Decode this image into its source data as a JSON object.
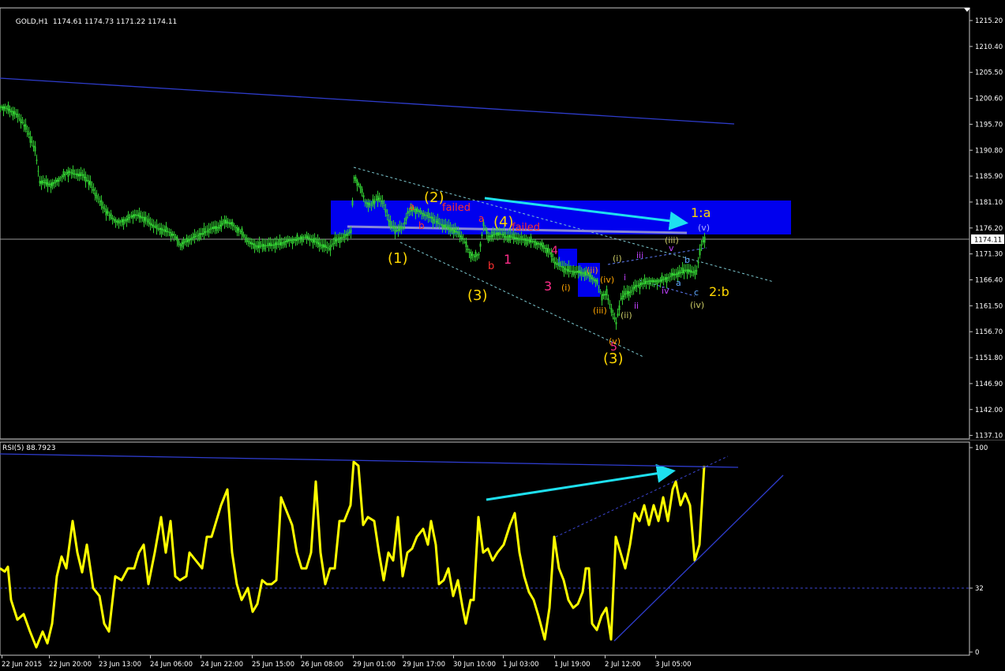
{
  "header": {
    "symbol": "GOLD,H1",
    "ohlc": "1174.61 1174.73 1171.22 1174.11",
    "menu_icon": "triangle-down-icon"
  },
  "rsi_header": "RSI(5) 88.7923",
  "price_axis": {
    "ticks": [
      "1215.20",
      "1210.40",
      "1205.50",
      "1200.60",
      "1195.70",
      "1190.80",
      "1185.90",
      "1181.10",
      "1176.20",
      "1171.30",
      "1166.40",
      "1161.50",
      "1156.70",
      "1151.80",
      "1146.90",
      "1142.00",
      "1137.10"
    ],
    "current_price": "1174.11"
  },
  "rsi_axis": {
    "ticks": [
      "100",
      "32",
      "0"
    ]
  },
  "time_axis": {
    "ticks": [
      "22 Jun 2015",
      "22 Jun 20:00",
      "23 Jun 13:00",
      "24 Jun 06:00",
      "24 Jun 22:00",
      "25 Jun 15:00",
      "26 Jun 08:00",
      "29 Jun 01:00",
      "29 Jun 17:00",
      "30 Jun 10:00",
      "1 Jul 03:00",
      "1 Jul 19:00",
      "2 Jul 12:00",
      "3 Jul 05:00"
    ]
  },
  "wave_labels": {
    "yellow_2": "(2)",
    "yellow_1": "(1)",
    "yellow_3a": "(3)",
    "yellow_4": "(4)",
    "yellow_3b": "(3)",
    "yellow_1a": "1:a",
    "yellow_2b": "2:b",
    "red_failed1": "failed",
    "red_failed2": "failed",
    "red_a1": "a",
    "red_b1": "b",
    "red_a2": "a",
    "red_b2": "b",
    "mag_1": "1",
    "mag_3": "3",
    "mag_4": "4",
    "mag_5": "5",
    "or_i": "(i)",
    "or_ii": "(ii)",
    "or_iii": "(iii)",
    "or_iv": "(iv)",
    "or_v": "(v)",
    "g_i": "(i)",
    "g_ii": "(ii)",
    "g_iii": "(iii)",
    "g_iv": "(iv)",
    "g_v": "(v)",
    "p_i": "i",
    "p_ii": "ii",
    "p_iii": "iii",
    "p_iv": "iv",
    "p_v": "v",
    "b_a": "a",
    "b_b": "b",
    "b_c": "c"
  },
  "colors": {
    "candle": "#32cd32",
    "rsi_line": "#ffff00",
    "arrow": "#1ee0f0",
    "zone": "#0000ee",
    "trendline": "#2e3ccc",
    "grey_line": "#7a7ad0",
    "wave_yellow": "#ffd700",
    "wave_red": "#ff3030",
    "wave_magenta": "#ff2d8a",
    "wave_orange": "#ffa500",
    "wave_olive": "#c8c864",
    "wave_purple": "#c040ff",
    "wave_blue": "#60a8ff"
  }
}
